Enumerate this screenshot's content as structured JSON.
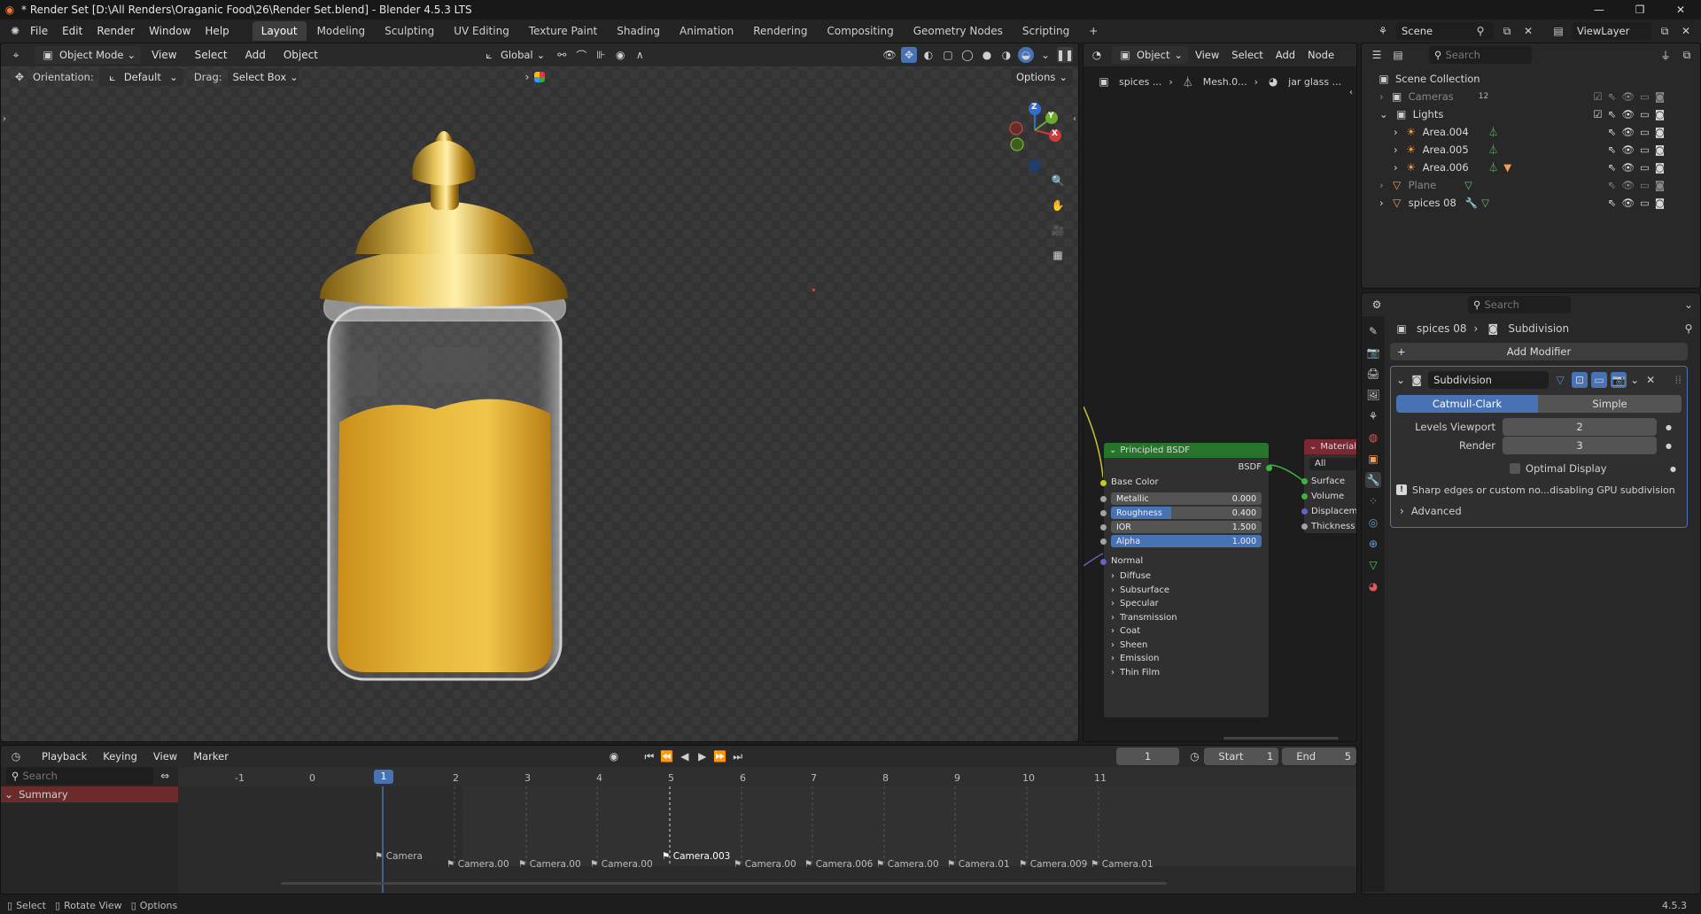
{
  "window": {
    "title": "* Render Set [D:\\All Renders\\Oraganic Food\\26\\Render Set.blend] - Blender 4.5.3 LTS",
    "minimize": "—",
    "maximize": "❐",
    "close": "✕"
  },
  "menubar": {
    "items": [
      "File",
      "Edit",
      "Render",
      "Window",
      "Help"
    ],
    "workspaces": [
      "Layout",
      "Modeling",
      "Sculpting",
      "UV Editing",
      "Texture Paint",
      "Shading",
      "Animation",
      "Rendering",
      "Compositing",
      "Geometry Nodes",
      "Scripting"
    ],
    "active_workspace": "Layout",
    "add_tab": "+",
    "scene_label": "Scene",
    "viewlayer_label": "ViewLayer"
  },
  "viewport": {
    "mode": "Object Mode",
    "menus": [
      "View",
      "Select",
      "Add",
      "Object"
    ],
    "transform": "Global",
    "orientation_label": "Orientation:",
    "orientation_value": "Default",
    "drag_label": "Drag:",
    "drag_value": "Select Box",
    "options": "Options",
    "gizmo": {
      "z": "Z",
      "x": "X",
      "y": "Y"
    }
  },
  "node_editor": {
    "type": "Object",
    "menus": [
      "View",
      "Select",
      "Add",
      "Node"
    ],
    "breadcrumb": [
      "spices ...",
      "Mesh.0...",
      "jar glass ..."
    ],
    "bsdf": {
      "title": "Principled BSDF",
      "output": "BSDF",
      "base_color": "Base Color",
      "fields": [
        {
          "label": "Metallic",
          "value": "0.000",
          "fill": 0
        },
        {
          "label": "Roughness",
          "value": "0.400",
          "fill": 0.4
        },
        {
          "label": "IOR",
          "value": "1.500",
          "fill": 0
        },
        {
          "label": "Alpha",
          "value": "1.000",
          "fill": 1
        }
      ],
      "normal": "Normal",
      "panels": [
        "Diffuse",
        "Subsurface",
        "Specular",
        "Transmission",
        "Coat",
        "Sheen",
        "Emission",
        "Thin Film"
      ]
    },
    "material_output": {
      "title": "Material O",
      "target": "All",
      "inputs": [
        "Surface",
        "Volume",
        "Displacem",
        "Thickness"
      ]
    }
  },
  "outliner": {
    "search_placeholder": "Search",
    "root": "Scene Collection",
    "rows": [
      {
        "label": "Cameras",
        "badge": "12"
      },
      {
        "label": "Lights"
      },
      {
        "label": "Area.004"
      },
      {
        "label": "Area.005"
      },
      {
        "label": "Area.006"
      },
      {
        "label": "Plane"
      },
      {
        "label": "spices 08"
      }
    ]
  },
  "properties": {
    "search_placeholder": "Search",
    "object": "spices 08",
    "modifier_crumb": "Subdivision",
    "add_modifier": "Add Modifier",
    "modifier_name": "Subdivision",
    "catmull": "Catmull-Clark",
    "simple": "Simple",
    "levels_viewport_label": "Levels Viewport",
    "levels_viewport": "2",
    "render_label": "Render",
    "render_value": "3",
    "optimal_display": "Optimal Display",
    "warning": "Sharp edges or custom no...disabling GPU subdivision",
    "advanced": "Advanced"
  },
  "timeline": {
    "menus": [
      "Playback",
      "Keying",
      "View",
      "Marker"
    ],
    "current_frame": "1",
    "start_label": "Start",
    "start_value": "1",
    "end_label": "End",
    "end_value": "5",
    "search_placeholder": "Search",
    "summary": "Summary",
    "ticks": [
      "-1",
      "0",
      "1",
      "2",
      "3",
      "4",
      "5",
      "6",
      "7",
      "8",
      "9",
      "10",
      "11"
    ],
    "markers": [
      "Camera",
      "Camera.00",
      "Camera.00",
      "Camera.00",
      "Camera.003",
      "Camera.00",
      "Camera.006",
      "Camera.00",
      "Camera.01",
      "Camera.009",
      "Camera.01"
    ]
  },
  "statusbar": {
    "select": "Select",
    "rotate": "Rotate View",
    "options": "Options",
    "version": "4.5.3"
  }
}
